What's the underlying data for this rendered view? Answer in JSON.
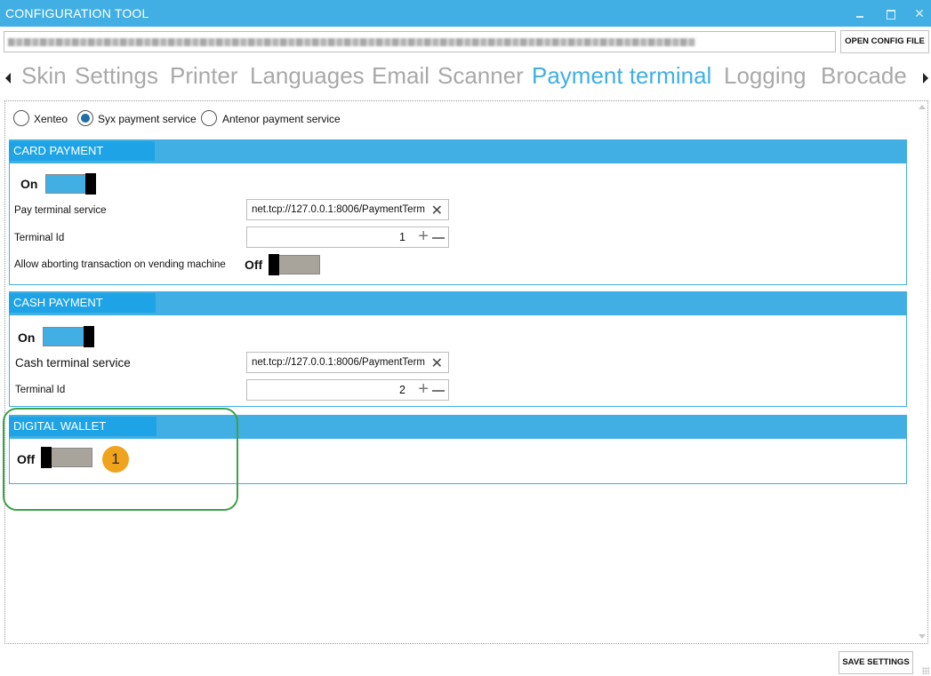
{
  "window": {
    "title": "CONFIGURATION TOOL"
  },
  "toolbar": {
    "open_label": "OPEN CONFIG FILE",
    "save_label": "SAVE SETTINGS"
  },
  "tabs": [
    {
      "label": "Skin"
    },
    {
      "label": "Settings"
    },
    {
      "label": "Printer"
    },
    {
      "label": "Languages"
    },
    {
      "label": "Email"
    },
    {
      "label": "Scanner"
    },
    {
      "label": "Payment terminal",
      "active": true
    },
    {
      "label": "Logging"
    },
    {
      "label": "Brocade"
    }
  ],
  "providers": {
    "options": [
      "Xenteo",
      "Syx payment service",
      "Antenor payment service"
    ],
    "selected": "Syx payment service"
  },
  "card_payment": {
    "title": "CARD PAYMENT",
    "toggle": {
      "state": "On",
      "on": true
    },
    "service_label": "Pay terminal service",
    "service_value": "net.tcp://127.0.0.1:8006/PaymentTerm",
    "terminal_id_label": "Terminal Id",
    "terminal_id": "1",
    "abort_label": "Allow aborting transaction on vending machine",
    "abort_toggle": {
      "state": "Off",
      "on": false
    }
  },
  "cash_payment": {
    "title": "CASH PAYMENT",
    "toggle": {
      "state": "On",
      "on": true
    },
    "service_label": "Cash terminal service",
    "service_value": "net.tcp://127.0.0.1:8006/PaymentTerm",
    "terminal_id_label": "Terminal Id",
    "terminal_id": "2"
  },
  "digital_wallet": {
    "title": "DIGITAL WALLET",
    "toggle": {
      "state": "Off",
      "on": false
    },
    "callout": "1"
  },
  "colors": {
    "accent": "#41afe3",
    "highlight": "#3fa14a",
    "badge": "#f0a31c",
    "toggle_off": "#a8a49b"
  }
}
